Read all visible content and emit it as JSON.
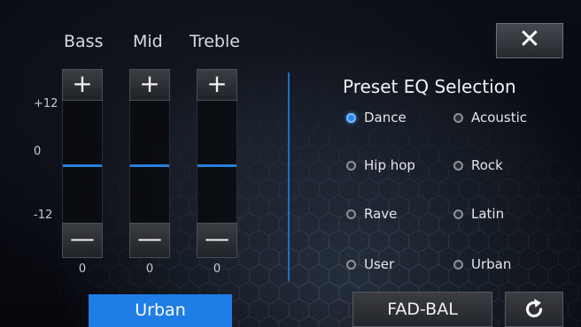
{
  "equalizer": {
    "bands": [
      {
        "label": "Bass",
        "plus": "+",
        "minus": "—",
        "value": "0",
        "level": 0
      },
      {
        "label": "Mid",
        "plus": "+",
        "minus": "—",
        "value": "0",
        "level": 0
      },
      {
        "label": "Treble",
        "plus": "+",
        "minus": "—",
        "value": "0",
        "level": 0
      }
    ],
    "scale_max": "+12",
    "scale_zero": "0",
    "scale_min": "-12",
    "current_preset": "Urban"
  },
  "close_icon": "close-icon",
  "preset": {
    "title": "Preset EQ Selection",
    "options": [
      "Dance",
      "Acoustic",
      "Hip hop",
      "Rock",
      "Rave",
      "Latin",
      "User",
      "Urban"
    ],
    "selected": "Dance"
  },
  "footer": {
    "fadbal_label": "FAD-BAL",
    "reset_icon": "reset-icon"
  },
  "colors": {
    "accent": "#1f7de6",
    "level_line": "#2a7fd8",
    "background": "#05080e"
  }
}
